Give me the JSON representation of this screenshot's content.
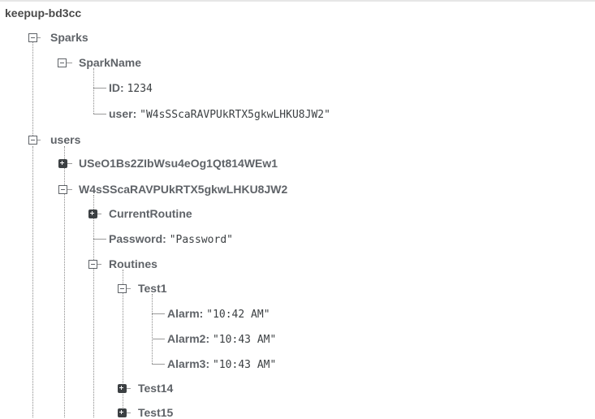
{
  "root": "keepup-bd3cc",
  "sparks": {
    "key": "Sparks",
    "sparkname": {
      "key": "SparkName",
      "id_key": "ID:",
      "id_value": "1234",
      "user_key": "user:",
      "user_value": "\"W4sSScaRAVPUkRTX5gkwLHKU8JW2\""
    }
  },
  "users": {
    "key": "users",
    "user1": {
      "key": "USeO1Bs2ZIbWsu4eOg1Qt814WEw1"
    },
    "user2": {
      "key": "W4sSScaRAVPUkRTX5gkwLHKU8JW2",
      "current_routine": "CurrentRoutine",
      "password_key": "Password:",
      "password_value": "\"Password\"",
      "routines": {
        "key": "Routines",
        "test1": {
          "key": "Test1",
          "alarm_key": "Alarm:",
          "alarm_value": "\"10:42 AM\"",
          "alarm2_key": "Alarm2:",
          "alarm2_value": "\"10:43 AM\"",
          "alarm3_key": "Alarm3:",
          "alarm3_value": "\"10:43 AM\""
        },
        "test14": "Test14",
        "test15": "Test15"
      }
    }
  }
}
